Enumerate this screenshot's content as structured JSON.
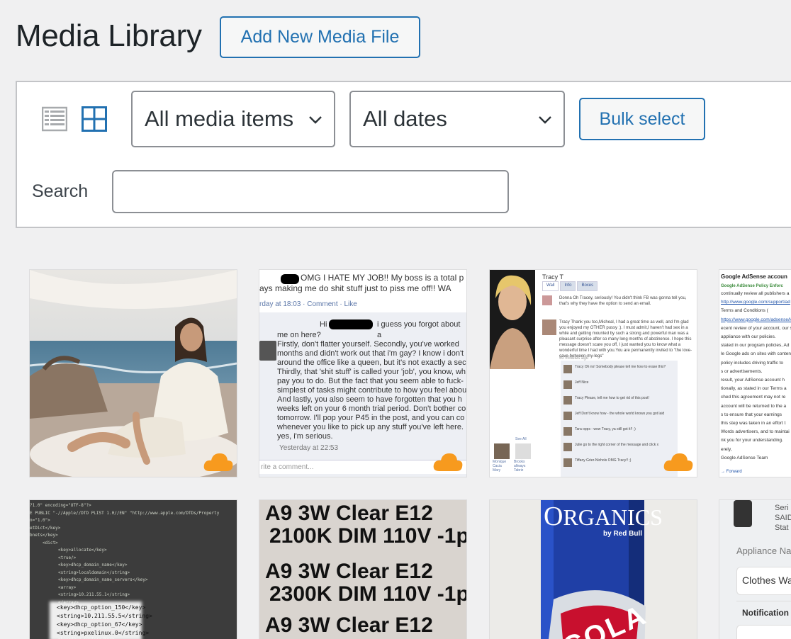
{
  "page": {
    "title": "Media Library",
    "add_new_label": "Add New Media File"
  },
  "toolbar": {
    "view_list_icon": "list-view-icon",
    "view_grid_icon": "grid-view-icon",
    "media_filter": {
      "selected": "All media items"
    },
    "date_filter": {
      "selected": "All dates"
    },
    "bulk_select_label": "Bulk select",
    "search_label": "Search",
    "search_value": ""
  },
  "colors": {
    "accent": "#2271b1",
    "cloud_badge": "#f79a1e",
    "active_view": "#2271b1",
    "inactive_view": "#a7aaad"
  },
  "thumbnails": {
    "fb_post": {
      "line1": "OMG I HATE MY JOB!! My boss is a total p",
      "line2": "ays making me do shit stuff just to piss me off!! WA",
      "meta": "rday at 18:03 · Comment · Like",
      "reply_lead": "Hi",
      "reply_rest": "i guess you forgot about a",
      "body": [
        "me on here?",
        "Firstly, don't flatter yourself. Secondly, you've worked",
        "months and didn't work out that i'm gay? I know i don't",
        "around the office like a queen, but it's not exactly a sec",
        "Thirdly, that 'shit stuff' is called your 'job', you know, wh",
        "pay you to do. But the fact that you seem able to fuck-",
        "simplest of tasks might contribute to how you feel abou",
        "And lastly, you also seem to have forgotten that you h",
        "weeks left on your 6 month trial period. Don't bother co",
        "tomorrow. I'll pop your P45 in the post, and you can co",
        "whenever you like to pick up any stuff you've left here.",
        "yes, i'm serious."
      ],
      "reply_meta": "Yesterday at 22:53",
      "comment_placeholder": "rite a comment..."
    },
    "fb_profile": {
      "name": "Tracy T",
      "tabs": [
        "Wall",
        "Info",
        "Boxes"
      ],
      "post1": "Donna   Oh Tracey, seriously! You didn't think FB was gonna tell you, that's why they have the option to send an email.",
      "post2": "Tracy   Thank you too,Micheal, I had a great time as well, and I'm glad you enjoyed my OTHER pussy ;). I must admit,I haven't had sex in a while and getting mounted by such a strong and powerful man was a pleasant surprise after so many long months of abstinence. I hope this message doesn't scare you off, I just wanted you to know what a wonderful time I had with you.You are permanently invited to \"the love-cave-between-my-legs\"",
      "time": "50 minutes ago",
      "replies": [
        "Tracy   Oh no! Somebody please tell me how to erase this?",
        "Jeff   Nice",
        "Tracy   Please, tell me how to get rid of this post!",
        "Jeff   Don't know how - the whole world knows you got laid",
        "Tara   opps - wow Tracy, ya still got it!! ;)",
        "Julie   go to the right corner of the message and click x",
        "Tiffany Grier-Nichols OMG Tracy!! ;)"
      ],
      "friends": [
        "Monique",
        "Brooks",
        "Cacia",
        "allways",
        "Mary",
        "Tabriz"
      ],
      "see_all": "See All"
    },
    "adsense": {
      "heading": "Google AdSense accoun",
      "subheading": "Google AdSense Policy Enforc",
      "lines": [
        "continually review all publishers a",
        "http://www.google.com/support/ad",
        "Terms and Conditions (",
        "https://www.google.com/adsense/lo",
        "ecent review of your account, our s",
        "appliance with our policies.",
        "stated in our program policies, Ad",
        "le Google ads on sites with content",
        "policy includes driving traffic to",
        "s or advertisements.",
        "result, your AdSense account h",
        "tionally, as stated in our Terms a",
        "ched this agreement may not re",
        "account will be returned to the a",
        "s to ensure that your earnings",
        "this step was taken in an effort t",
        "Words advertisers, and to maintai",
        "nk you for your understanding.",
        "erely,",
        "Google AdSense Team"
      ],
      "forward": "Forward"
    },
    "plist": {
      "lines": [
        "?1.0\" encoding=\"UTF-8\"?>",
        "E PUBLIC \"-//Apple//DTD PLIST 1.0//EN\" \"http://www.apple.com/DTDs/Property",
        "n=\"1.0\">",
        "etDict</key>",
        "bnets</key>",
        "<dict>",
        "<key>allocate</key>",
        "<true/>",
        "<key>dhcp_domain_name</key>",
        "<string>localdomain</string>",
        "<key>dhcp_domain_name_servers</key>",
        "<array>",
        "<string>10.211.55.1</string>",
        "</array>",
        "<key>dhcp_option_150</key>",
        "<string>10.211.55.5</string>",
        "<key>dhcp_option_67</key>",
        "<string>pxelinux.0</string>",
        "<key>dhcp_router</key>"
      ]
    },
    "bulb_label": {
      "lines": [
        "A9 3W Clear E12",
        "2100K DIM 110V -1pc",
        "A9 3W Clear E12",
        "2300K DIM 110V -1pc",
        "A9 3W Clear E12"
      ]
    },
    "can": {
      "brand": "RGANICS",
      "brand_first": "O",
      "sub": "by Red Bull",
      "flavor": "COLA"
    },
    "appliance": {
      "serial": "Seri",
      "said": "SAID",
      "status": "Stat",
      "appliance_name": "Appliance Na",
      "clothes": "Clothes Wa",
      "notification": "Notification"
    }
  }
}
